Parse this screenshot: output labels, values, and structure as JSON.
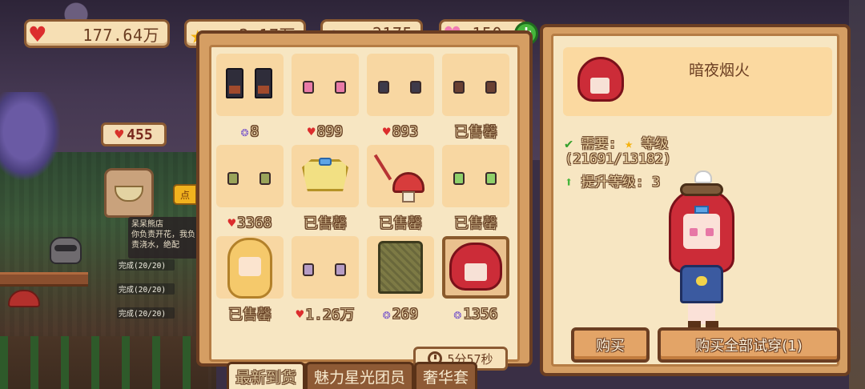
{
  "resources": {
    "hearts": "177.64万",
    "stars": "2.17万",
    "candy": "2175",
    "pink_hearts": "150",
    "add_label": "+"
  },
  "world": {
    "love_count": "455",
    "quest_title": "呆呆熊店",
    "quest_text": "你负责开花，我负责浇水，绝配",
    "quest_progress": [
      "完成(20/20)",
      "完成(20/20)",
      "完成(20/20)"
    ],
    "side_tab_label": "点"
  },
  "shop": {
    "items": [
      {
        "price": "8",
        "currency": "candy"
      },
      {
        "price": "899",
        "currency": "heart"
      },
      {
        "price": "893",
        "currency": "heart"
      },
      {
        "price": "已售罄",
        "currency": "none"
      },
      {
        "price": "3368",
        "currency": "heart"
      },
      {
        "price": "已售罄",
        "currency": "none"
      },
      {
        "price": "已售罄",
        "currency": "none"
      },
      {
        "price": "已售罄",
        "currency": "none"
      },
      {
        "price": "已售罄",
        "currency": "none"
      },
      {
        "price": "1.26万",
        "currency": "heart"
      },
      {
        "price": "269",
        "currency": "candy"
      },
      {
        "price": "1356",
        "currency": "candy"
      }
    ],
    "selected_index": 11,
    "timer": "5分57秒",
    "tabs": [
      "最新到货",
      "魅力星光团员",
      "奢华套"
    ],
    "active_tab": 0
  },
  "detail": {
    "item_name": "暗夜烟火",
    "requirement_label": "需要:",
    "requirement_suffix": "等级",
    "requirement_progress": "(21691/13182)",
    "upgrade_label": "提升等级: 3",
    "buy_label": "购买",
    "buy_all_label": "购买全部试穿(1)"
  },
  "icons": {
    "heart": "heart-icon",
    "star": "star-icon",
    "candy": "candy-icon",
    "pink_heart": "pink-heart-icon",
    "check": "check-icon",
    "up_arrow": "up-arrow-icon",
    "timer": "refresh-timer-icon"
  },
  "colors": {
    "accent_red": "#dc2d2d",
    "star_gold": "#f5b20f",
    "candy_purple": "#7a58c9",
    "pink_heart": "#f07bb3",
    "add_green": "#46b53c",
    "panel_border": "#6b3e22",
    "panel_fill": "#f7e6c2"
  }
}
